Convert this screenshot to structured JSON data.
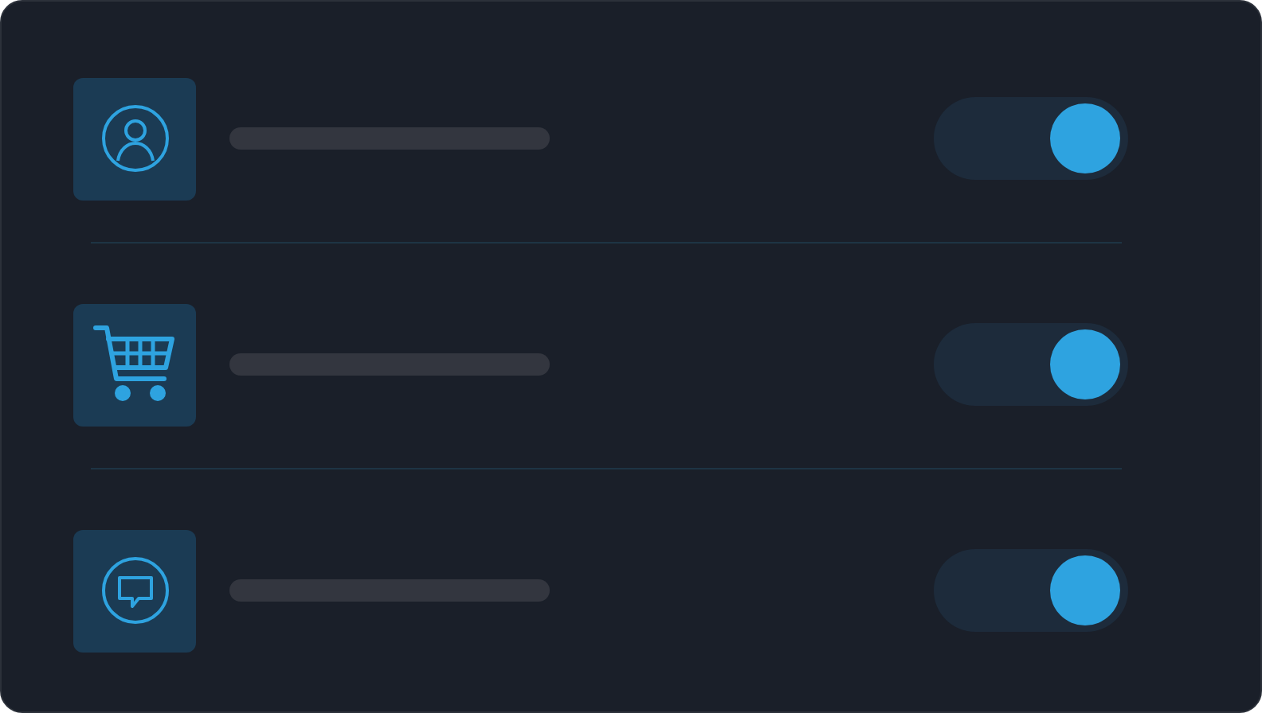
{
  "settings": [
    {
      "on": true
    },
    {
      "on": true
    },
    {
      "on": true
    }
  ]
}
